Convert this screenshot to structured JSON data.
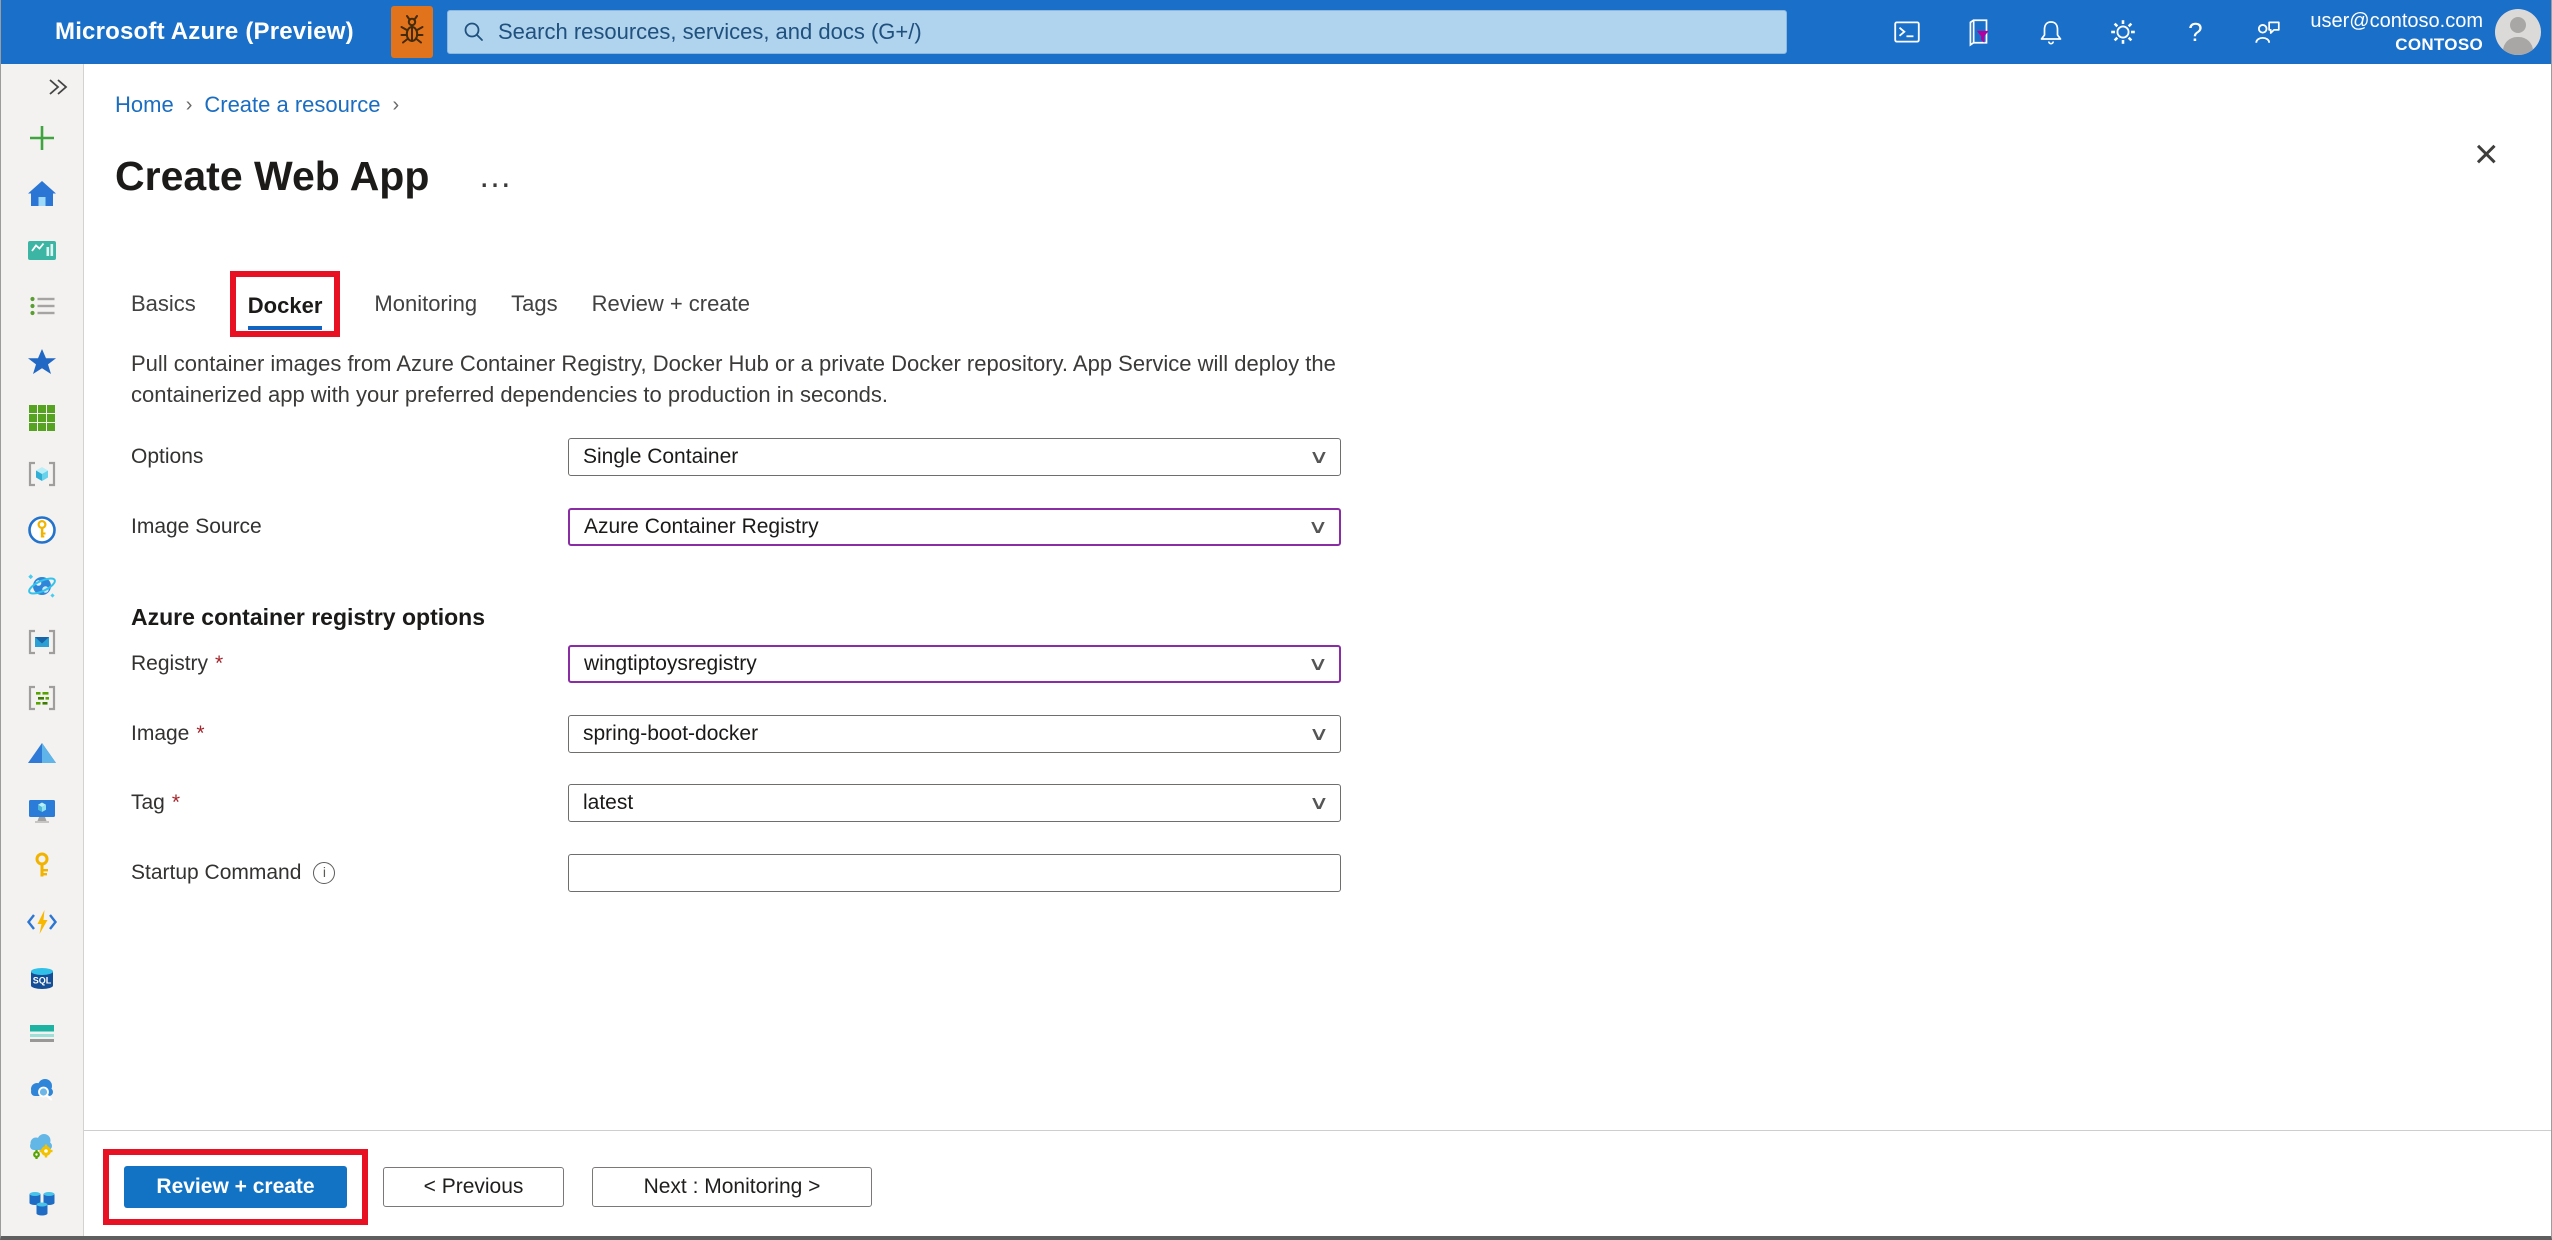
{
  "topbar": {
    "title": "Microsoft Azure (Preview)",
    "search_placeholder": "Search resources, services, and docs (G+/)",
    "user_email": "user@contoso.com",
    "user_tenant": "CONTOSO",
    "icons": [
      "bug-icon",
      "search-icon",
      "cloud-shell-icon",
      "directory-filter-icon",
      "notifications-icon",
      "settings-icon",
      "help-icon",
      "feedback-icon",
      "avatar"
    ],
    "help_glyph": "?"
  },
  "sidebar": {
    "expand_glyph": "»",
    "items": [
      "create-a-resource",
      "home",
      "dashboard",
      "all-services",
      "favorites",
      "all-resources",
      "app-services",
      "quickstart-center",
      "azure-cosmos-db",
      "service-bus",
      "batch-accounts",
      "azure-active-directory",
      "virtual-machines",
      "key-vaults",
      "function-apps",
      "sql-databases",
      "storage-accounts",
      "azure-monitor",
      "cloud-services",
      "all-databases"
    ]
  },
  "breadcrumb": {
    "items": [
      {
        "label": "Home"
      },
      {
        "label": "Create a resource"
      }
    ],
    "separator": "›"
  },
  "page": {
    "title": "Create Web App",
    "menu_ellipsis": "…",
    "close_glyph": "×"
  },
  "tabs": {
    "items": [
      {
        "label": "Basics"
      },
      {
        "label": "Docker",
        "active": true,
        "highlighted": true
      },
      {
        "label": "Monitoring"
      },
      {
        "label": "Tags"
      },
      {
        "label": "Review + create"
      }
    ]
  },
  "content": {
    "description": "Pull container images from Azure Container Registry, Docker Hub or a private Docker repository. App Service will deploy the containerized app with your preferred dependencies to production in seconds."
  },
  "form": {
    "required_marker": "*",
    "chevron": "∨",
    "info_glyph": "i",
    "section_title": "Azure container registry options",
    "rows": [
      {
        "label": "Options",
        "value": "Single Container",
        "control": "dropdown",
        "required": false,
        "modified": false
      },
      {
        "label": "Image Source",
        "value": "Azure Container Registry",
        "control": "dropdown",
        "required": false,
        "modified": true
      },
      {
        "label": "Registry",
        "value": "wingtiptoysregistry",
        "control": "dropdown",
        "required": true,
        "modified": true
      },
      {
        "label": "Image",
        "value": "spring-boot-docker",
        "control": "dropdown",
        "required": true,
        "modified": false
      },
      {
        "label": "Tag",
        "value": "latest",
        "control": "dropdown",
        "required": true,
        "modified": false
      },
      {
        "label": "Startup Command",
        "value": "",
        "control": "text",
        "required": false,
        "modified": false,
        "has_info": true
      }
    ]
  },
  "footer": {
    "primary": "Review + create",
    "previous": "< Previous",
    "next": "Next : Monitoring >"
  },
  "colors": {
    "topbar_blue": "#1a6fc8",
    "search_bg": "#b0d3ee",
    "bug_orange": "#e2731d",
    "link_blue": "#1a6dc0",
    "tab_underline_blue": "#1065c0",
    "modified_border_purple": "#8a2da5",
    "required_red": "#a4262c",
    "annotation_red": "#e81123",
    "primary_button_blue": "#1273c4",
    "sidebar_gray": "#f3f2f1"
  }
}
